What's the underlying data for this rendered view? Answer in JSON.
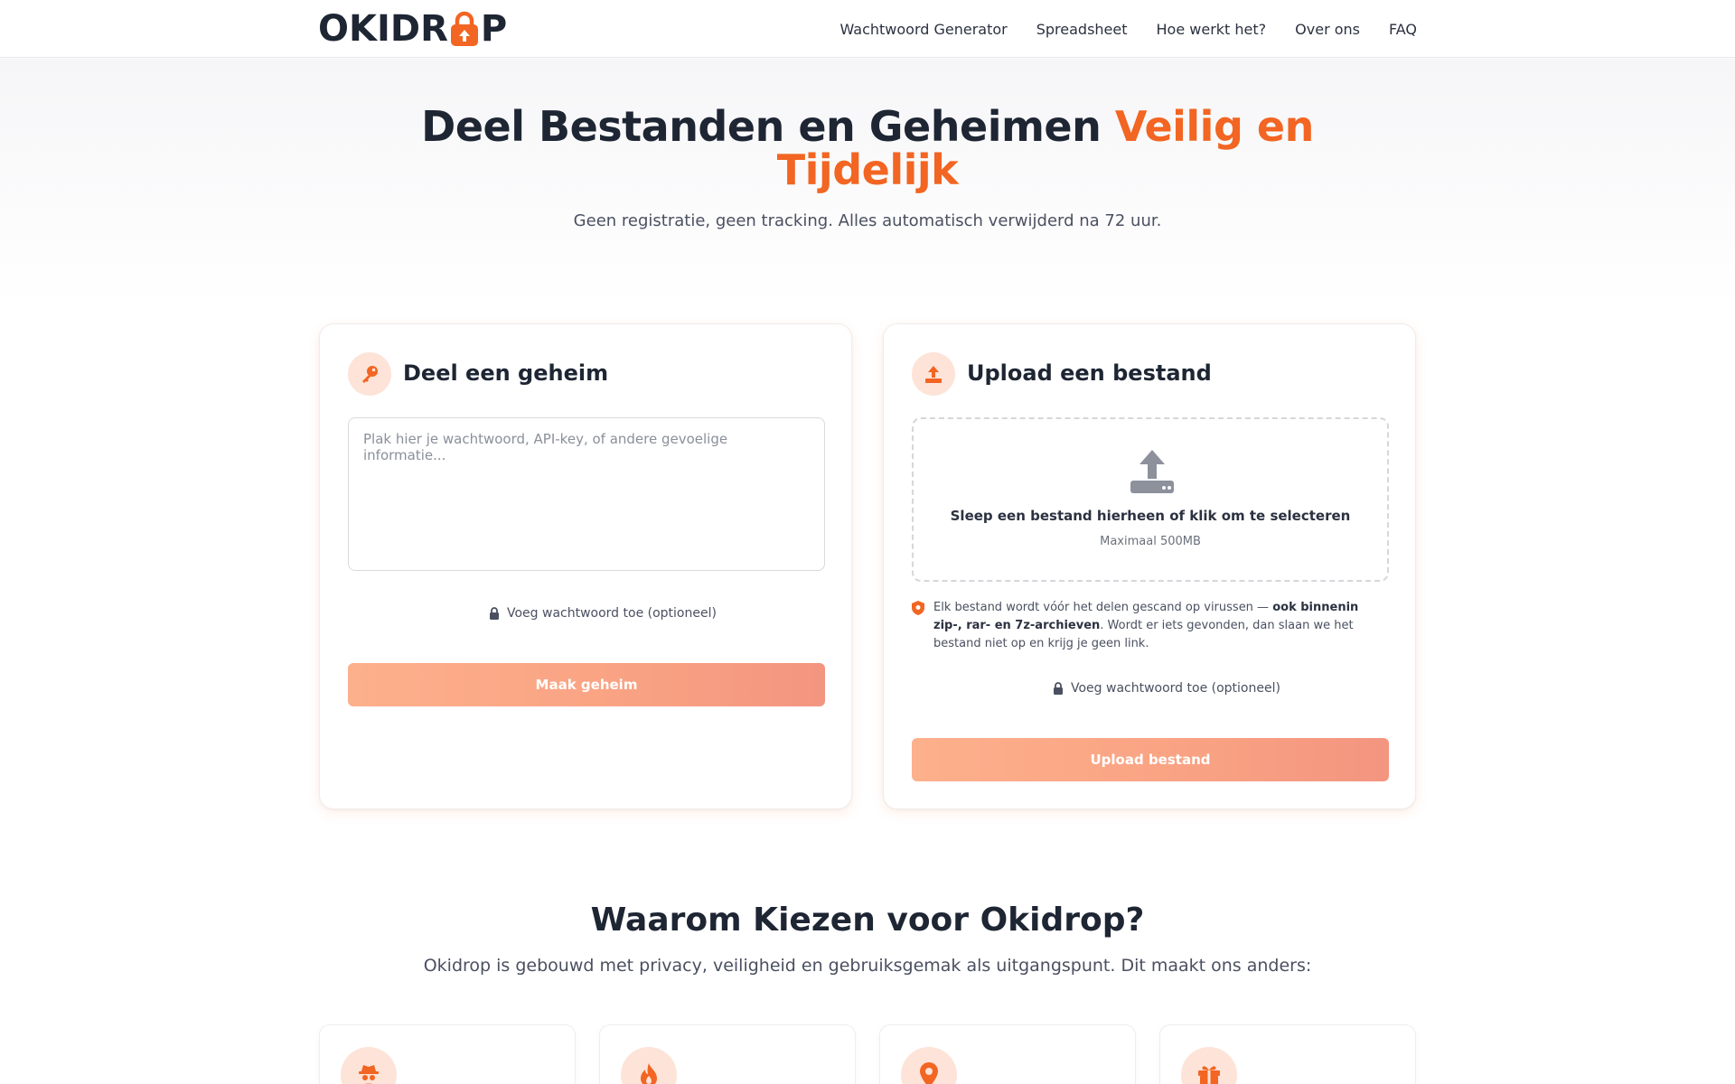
{
  "header": {
    "logo_left": "OKIDR",
    "logo_right": "P",
    "nav": [
      {
        "label": "Wachtwoord Generator"
      },
      {
        "label": "Spreadsheet"
      },
      {
        "label": "Hoe werkt het?"
      },
      {
        "label": "Over ons"
      },
      {
        "label": "FAQ"
      }
    ]
  },
  "hero": {
    "title_main": "Deel Bestanden en Geheimen ",
    "title_accent": "Veilig en Tijdelijk",
    "subtitle": "Geen registratie, geen tracking. Alles automatisch verwijderd na 72 uur."
  },
  "secret_card": {
    "icon": "key-icon",
    "title": "Deel een geheim",
    "textarea_placeholder": "Plak hier je wachtwoord, API-key, of andere gevoelige informatie...",
    "password_toggle": "Voeg wachtwoord toe (optioneel)",
    "button": "Maak geheim"
  },
  "upload_card": {
    "icon": "upload-icon",
    "title": "Upload een bestand",
    "drop_text": "Sleep een bestand hierheen of klik om te selecteren",
    "drop_sub": "Maximaal 500MB",
    "scan_note_start": "Elk bestand wordt vóór het delen gescand op virussen — ",
    "scan_note_bold": "ook binnenin zip-, rar- en 7z-archieven",
    "scan_note_end": ". Wordt er iets gevonden, dan slaan we het bestand niet op en krijg je geen link.",
    "password_toggle": "Voeg wachtwoord toe (optioneel)",
    "button": "Upload bestand"
  },
  "why": {
    "title": "Waarom Kiezen voor Okidrop?",
    "subtitle": "Okidrop is gebouwd met privacy, veiligheid en gebruiksgemak als uitgangspunt. Dit maakt ons anders:",
    "features": [
      {
        "icon": "spy-icon"
      },
      {
        "icon": "fire-icon"
      },
      {
        "icon": "location-pin-icon"
      },
      {
        "icon": "gift-icon"
      }
    ]
  },
  "colors": {
    "accent": "#f26522",
    "accent_light": "#fde3d8",
    "text_dark": "#1e2533",
    "button_gradient_start": "#fdb08c",
    "button_gradient_end": "#f39580"
  }
}
